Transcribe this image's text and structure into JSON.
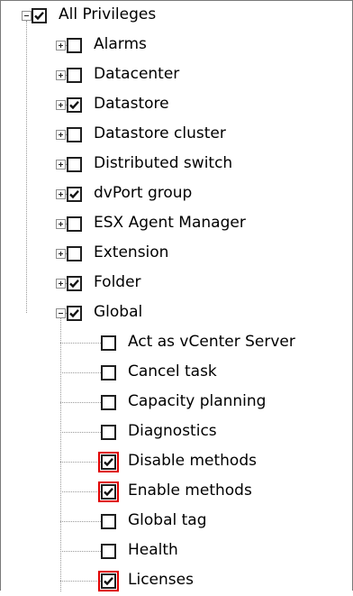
{
  "tree": {
    "root": {
      "label": "All Privileges",
      "checked": true,
      "expanded": true
    },
    "items": [
      {
        "label": "Alarms",
        "checked": false,
        "expandable": true,
        "expanded": false
      },
      {
        "label": "Datacenter",
        "checked": false,
        "expandable": true,
        "expanded": false
      },
      {
        "label": "Datastore",
        "checked": true,
        "expandable": true,
        "expanded": false
      },
      {
        "label": "Datastore cluster",
        "checked": false,
        "expandable": true,
        "expanded": false
      },
      {
        "label": "Distributed switch",
        "checked": false,
        "expandable": true,
        "expanded": false
      },
      {
        "label": "dvPort group",
        "checked": true,
        "expandable": true,
        "expanded": false
      },
      {
        "label": "ESX Agent Manager",
        "checked": false,
        "expandable": true,
        "expanded": false
      },
      {
        "label": "Extension",
        "checked": false,
        "expandable": true,
        "expanded": false
      },
      {
        "label": "Folder",
        "checked": true,
        "expandable": true,
        "expanded": false
      },
      {
        "label": "Global",
        "checked": true,
        "expandable": true,
        "expanded": true,
        "children": [
          {
            "label": "Act as vCenter Server",
            "checked": false,
            "highlighted": false
          },
          {
            "label": "Cancel task",
            "checked": false,
            "highlighted": false
          },
          {
            "label": "Capacity planning",
            "checked": false,
            "highlighted": false
          },
          {
            "label": "Diagnostics",
            "checked": false,
            "highlighted": false
          },
          {
            "label": "Disable methods",
            "checked": true,
            "highlighted": true
          },
          {
            "label": "Enable methods",
            "checked": true,
            "highlighted": true
          },
          {
            "label": "Global tag",
            "checked": false,
            "highlighted": false
          },
          {
            "label": "Health",
            "checked": false,
            "highlighted": false
          },
          {
            "label": "Licenses",
            "checked": true,
            "highlighted": true
          }
        ]
      }
    ]
  },
  "colors": {
    "highlight": "#e00000",
    "checkbox_border": "#1f1f1f",
    "tree_lines": "#9a9a9a"
  },
  "icons": {
    "expand": "plus-box-icon",
    "collapse": "minus-box-icon",
    "check": "checkmark-icon"
  }
}
